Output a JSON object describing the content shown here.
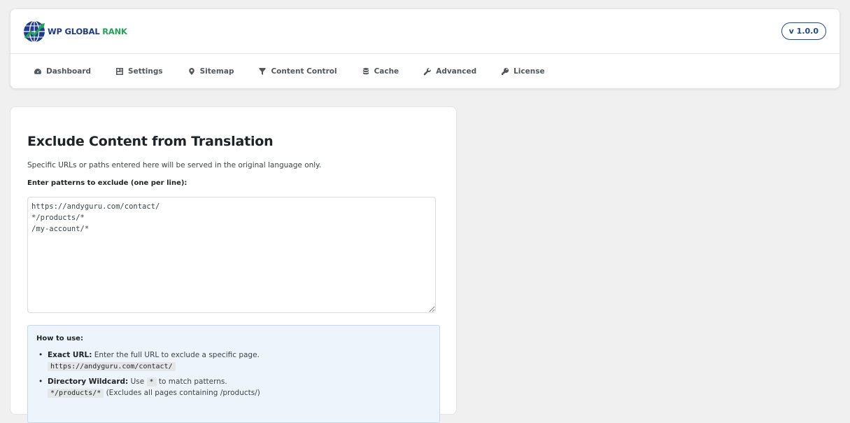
{
  "header": {
    "logo_text_primary": "WP GLOBAL",
    "logo_text_accent": "RANK",
    "version": "v 1.0.0"
  },
  "nav": {
    "items": [
      {
        "label": "Dashboard",
        "icon": "dashboard-icon"
      },
      {
        "label": "Settings",
        "icon": "settings-icon"
      },
      {
        "label": "Sitemap",
        "icon": "location-pin-icon"
      },
      {
        "label": "Content Control",
        "icon": "filter-icon"
      },
      {
        "label": "Cache",
        "icon": "database-icon"
      },
      {
        "label": "Advanced",
        "icon": "wrench-icon"
      },
      {
        "label": "License",
        "icon": "key-icon"
      }
    ]
  },
  "main": {
    "title": "Exclude Content from Translation",
    "description": "Specific URLs or paths entered here will be served in the original language only.",
    "field_label": "Enter patterns to exclude (one per line):",
    "patterns_value": "https://andyguru.com/contact/\n*/products/*\n/my-account/*",
    "help": {
      "title": "How to use:",
      "items": [
        {
          "label": "Exact URL:",
          "text": " Enter the full URL to exclude a specific page.",
          "code": "https://andyguru.com/contact/"
        },
        {
          "label": "Directory Wildcard:",
          "text_before": " Use ",
          "inline_code": "*",
          "text_after": " to match patterns.",
          "code": "*/products/*",
          "code_note": " (Excludes all pages containing /products/)"
        }
      ]
    }
  },
  "colors": {
    "brand_blue": "#1e3a8a",
    "brand_green": "#22a35a",
    "help_bg": "#eef4fb"
  }
}
